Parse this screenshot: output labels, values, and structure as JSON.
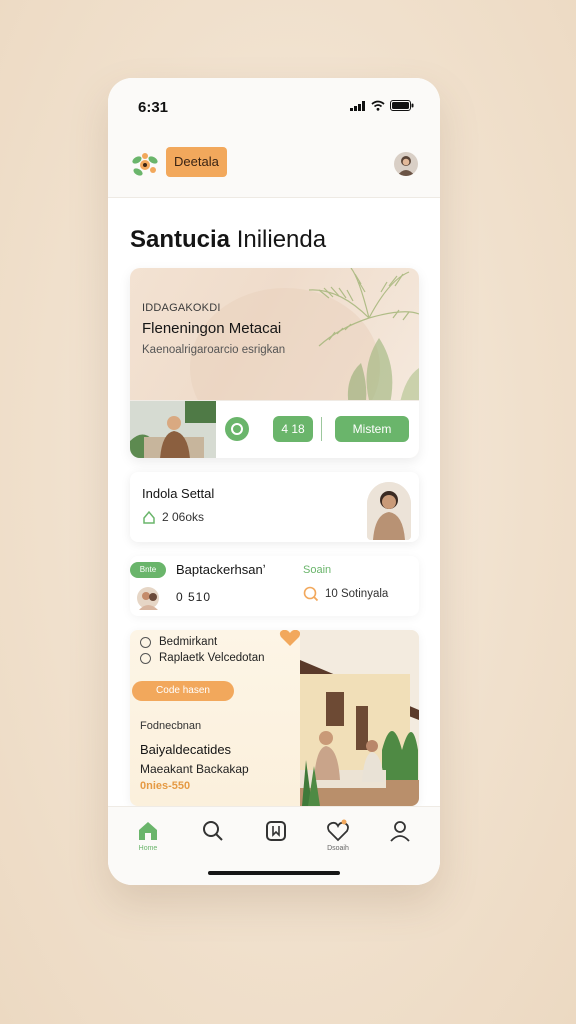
{
  "status_bar": {
    "time": "6:31"
  },
  "header": {
    "brand": "Deetala"
  },
  "page": {
    "title_bold": "Santucia",
    "title_rest": " Inilienda"
  },
  "hero": {
    "eyebrow": "IDDAGAKOKDI",
    "title": "Fleneningon Metacai",
    "subtitle": "Kaenoalrigaroarcio esrigkan",
    "count_label": "4 18",
    "cta_label": "Mistem"
  },
  "listing": {
    "title": "Indola Settal",
    "meta": "2 06oks"
  },
  "row2": {
    "tag": "Bnte",
    "title": "Baptackerhsanʼ",
    "number": "0 510",
    "link": "Soain",
    "meta": "10 Sotinyala"
  },
  "feature": {
    "option_1": "Bedmirkant",
    "option_2": "Raplaetk Velcedotan",
    "button_label": "Code hasen",
    "label": "Fodnecbnan",
    "title": "Baiyaldecatides",
    "subtitle": "Maeakant Backakap",
    "price": "0nies-550"
  },
  "bottom_nav": {
    "items": [
      {
        "icon": "home-icon",
        "label": "Home"
      },
      {
        "icon": "search-icon",
        "label": ""
      },
      {
        "icon": "bookmark-icon",
        "label": ""
      },
      {
        "icon": "heart-icon",
        "label": "Dsoaih"
      },
      {
        "icon": "user-icon",
        "label": ""
      }
    ]
  },
  "colors": {
    "accent_green": "#6ab56b",
    "accent_orange": "#f2a85c",
    "background": "#f1e2cf"
  }
}
